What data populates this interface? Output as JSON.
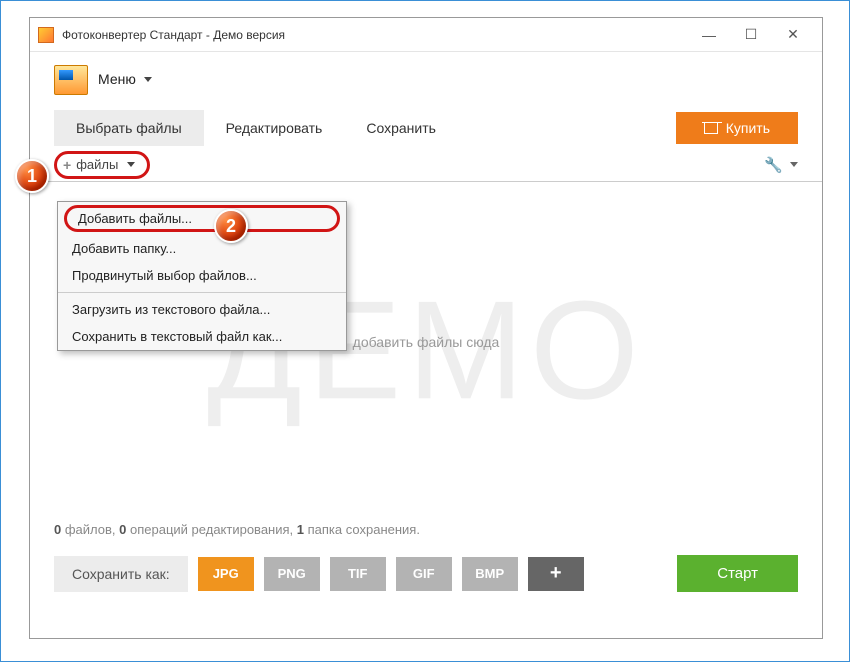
{
  "window": {
    "title": "Фотоконвертер Стандарт - Демо версия"
  },
  "menu": {
    "label": "Меню"
  },
  "tabs": {
    "select_files": "Выбрать файлы",
    "edit": "Редактировать",
    "save": "Сохранить"
  },
  "buy_button": "Купить",
  "files_button": "файлы",
  "dropdown": {
    "add_files": "Добавить файлы...",
    "add_folder": "Добавить папку...",
    "advanced": "Продвинутый выбор файлов...",
    "load_txt": "Загрузить из текстового файла...",
    "save_txt": "Сохранить в текстовый файл как..."
  },
  "canvas": {
    "watermark": "ДЕМО",
    "drop_hint": "добавить файлы сюда"
  },
  "status": {
    "files_count": "0",
    "files_word": "файлов,",
    "ops_count": "0",
    "ops_word": "операций редактирования,",
    "folders_count": "1",
    "folders_word": "папка сохранения."
  },
  "bottom": {
    "save_as": "Сохранить как:",
    "formats": {
      "jpg": "JPG",
      "png": "PNG",
      "tif": "TIF",
      "gif": "GIF",
      "bmp": "BMP"
    },
    "start": "Старт"
  },
  "badges": {
    "one": "1",
    "two": "2"
  }
}
